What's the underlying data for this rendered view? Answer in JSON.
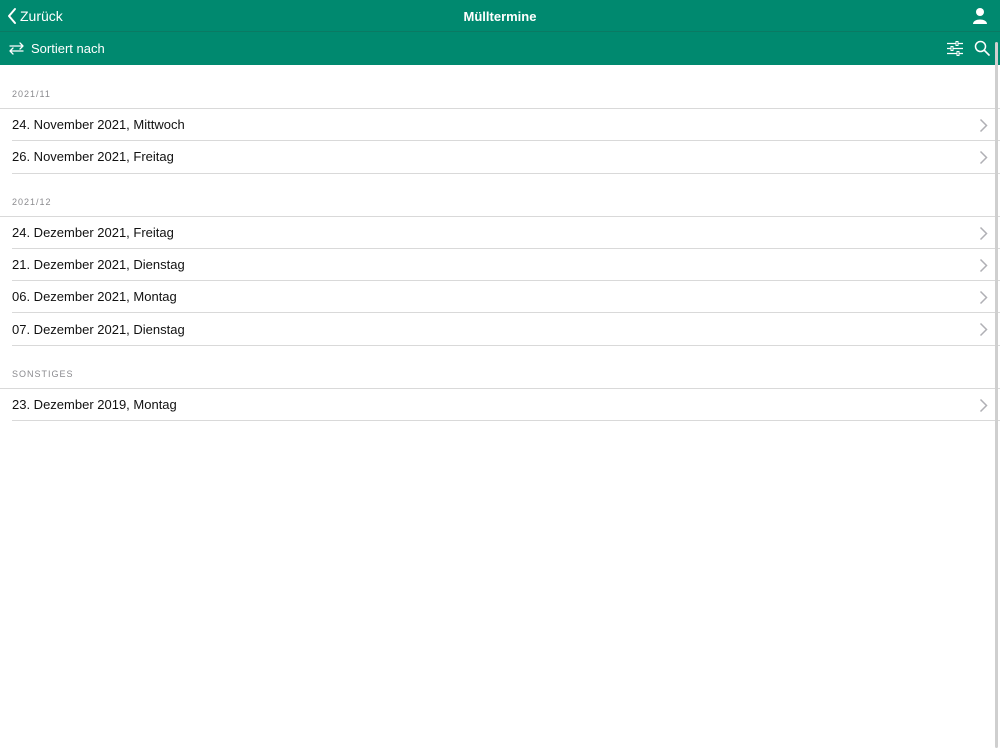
{
  "nav": {
    "back_label": "Zurück",
    "title": "Mülltermine",
    "user_icon": "person-icon"
  },
  "toolbar": {
    "sort_label": "Sortiert nach",
    "sort_icon": "sort-arrows-icon",
    "filter_icon": "sliders-icon",
    "search_icon": "search-icon"
  },
  "colors": {
    "accent": "#00896f",
    "section_text": "#8a8a8e",
    "separator": "#d9d9d9"
  },
  "sections": [
    {
      "header": "2021/11",
      "items": [
        "24. November 2021, Mittwoch",
        "26. November 2021, Freitag"
      ]
    },
    {
      "header": "2021/12",
      "items": [
        "24. Dezember 2021, Freitag",
        "21. Dezember 2021, Dienstag",
        "06. Dezember 2021, Montag",
        "07. Dezember 2021, Dienstag"
      ]
    },
    {
      "header": "SONSTIGES",
      "items": [
        "23. Dezember 2019, Montag"
      ]
    }
  ]
}
